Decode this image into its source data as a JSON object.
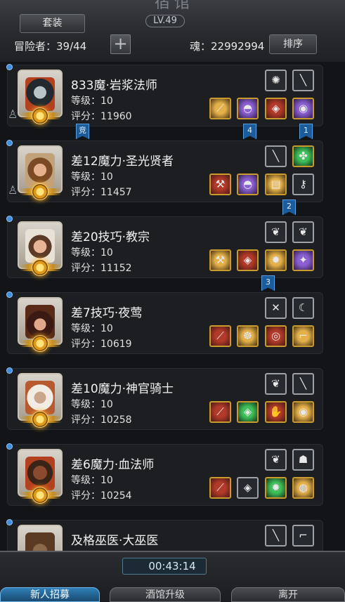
{
  "header": {
    "title_partial": "宿馆",
    "suit_button": "套装",
    "level_badge": "LV.49",
    "adventurers_label": "冒险者：39/44",
    "add_button": "+",
    "soul_label": "魂：22992994",
    "sort_button": "排序"
  },
  "characters": [
    {
      "name": "833魔·岩浆法师",
      "level": "等级：10",
      "score": "评分：11960",
      "slots_top": [
        {
          "icon": "orb-icon",
          "style": "grey"
        },
        {
          "icon": "wand-icon",
          "style": "grey"
        }
      ],
      "slots_bottom": [
        {
          "icon": "staff-icon",
          "style": "gold"
        },
        {
          "icon": "helmet-icon",
          "style": "purple"
        },
        {
          "icon": "armor-icon",
          "style": "red"
        },
        {
          "icon": "ring-icon",
          "style": "purple"
        }
      ]
    },
    {
      "name": "差12魔力·圣光贤者",
      "level": "等级：10",
      "score": "评分：11457",
      "slots_top": [
        {
          "icon": "sword-icon",
          "style": "grey"
        },
        {
          "icon": "charm-icon",
          "style": "green"
        }
      ],
      "slots_bottom": [
        {
          "icon": "hammer-icon",
          "style": "red"
        },
        {
          "icon": "helmet-icon",
          "style": "purple"
        },
        {
          "icon": "scroll-icon",
          "style": "gold"
        },
        {
          "icon": "key-icon",
          "style": "grey"
        }
      ]
    },
    {
      "name": "差20技巧·教宗",
      "level": "等级：10",
      "score": "评分：11152",
      "slots_top": [
        {
          "icon": "feather-icon",
          "style": "grey"
        },
        {
          "icon": "feather-icon",
          "style": "grey"
        }
      ],
      "slots_bottom": [
        {
          "icon": "hammer-icon",
          "style": "gold"
        },
        {
          "icon": "armor-icon",
          "style": "red"
        },
        {
          "icon": "gem-icon",
          "style": "gold"
        },
        {
          "icon": "shard-icon",
          "style": "purple"
        }
      ]
    },
    {
      "name": "差7技巧·夜莺",
      "level": "等级：10",
      "score": "评分：10619",
      "slots_top": [
        {
          "icon": "rune-icon",
          "style": "grey"
        },
        {
          "icon": "claw-icon",
          "style": "grey"
        }
      ],
      "slots_bottom": [
        {
          "icon": "dagger-icon",
          "style": "red"
        },
        {
          "icon": "mask-icon",
          "style": "gold"
        },
        {
          "icon": "amulet-icon",
          "style": "red"
        },
        {
          "icon": "boots-icon",
          "style": "gold"
        }
      ]
    },
    {
      "name": "差10魔力·神官骑士",
      "level": "等级：10",
      "score": "评分：10258",
      "slots_top": [
        {
          "icon": "feather-icon",
          "style": "grey"
        },
        {
          "icon": "wand-icon",
          "style": "grey"
        }
      ],
      "slots_bottom": [
        {
          "icon": "spear-icon",
          "style": "red"
        },
        {
          "icon": "armor-icon",
          "style": "green"
        },
        {
          "icon": "glove-icon",
          "style": "red"
        },
        {
          "icon": "ring-icon",
          "style": "gold"
        }
      ]
    },
    {
      "name": "差6魔力·血法师",
      "level": "等级：10",
      "score": "评分：10254",
      "slots_top": [
        {
          "icon": "feather-icon",
          "style": "grey"
        },
        {
          "icon": "mask-icon",
          "style": "grey"
        }
      ],
      "slots_bottom": [
        {
          "icon": "staff-icon",
          "style": "red"
        },
        {
          "icon": "armor-icon",
          "style": "grey"
        },
        {
          "icon": "gem-icon",
          "style": "green"
        },
        {
          "icon": "coin-icon",
          "style": "gold"
        }
      ]
    },
    {
      "name": "及格巫医·大巫医",
      "level": "",
      "score": "",
      "slots_top": [
        {
          "icon": "sword-icon",
          "style": "grey"
        },
        {
          "icon": "boot-icon",
          "style": "grey"
        }
      ],
      "slots_bottom": []
    }
  ],
  "flags": [
    {
      "label": "竞"
    },
    {
      "label": "4"
    },
    {
      "label": "1"
    },
    {
      "label": "2"
    },
    {
      "label": "3"
    }
  ],
  "footer": {
    "timer": "00:43:14",
    "tabs": [
      "新人招募",
      "酒馆升级",
      "离开"
    ]
  },
  "colors": {
    "accent_blue": "#2f7fb8",
    "gold": "#c99a2c",
    "bg": "#121417"
  }
}
